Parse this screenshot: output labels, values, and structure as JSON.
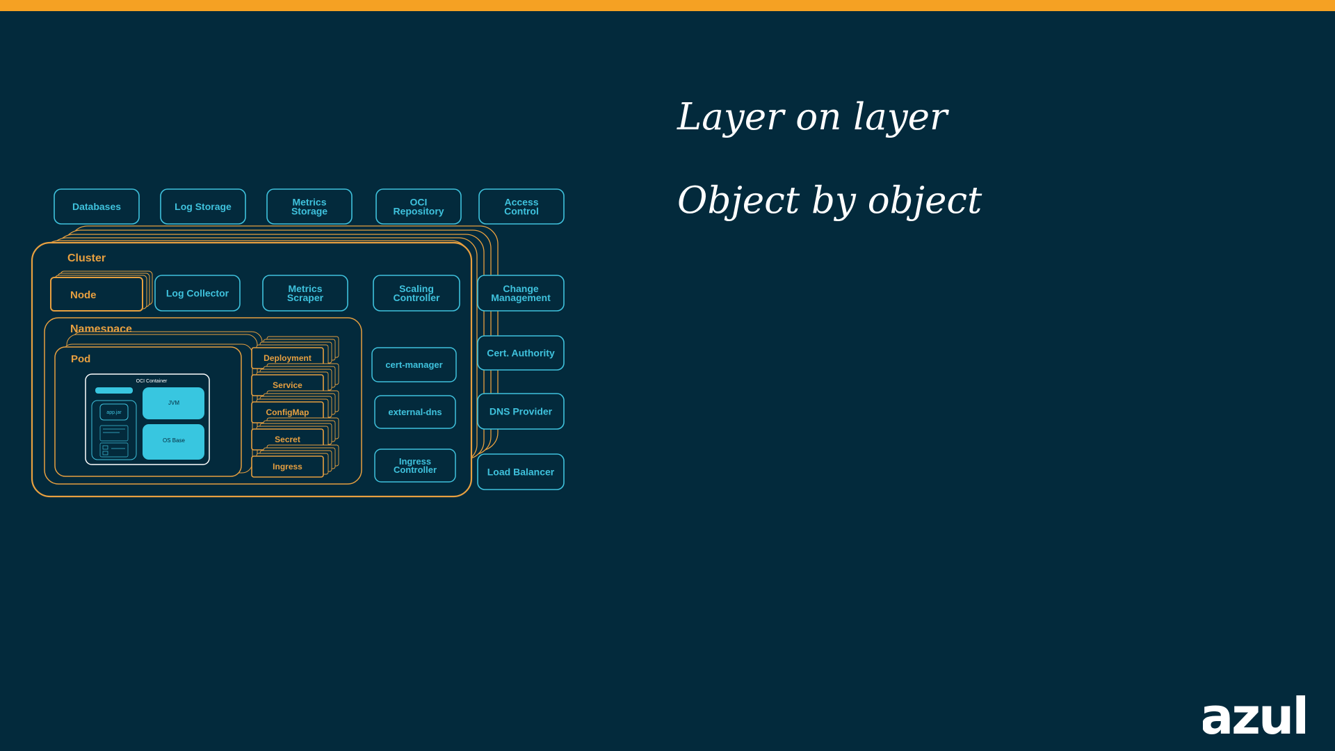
{
  "slide": {
    "title_line1": "Layer on layer",
    "title_line2": "Object by object",
    "brand": "azul"
  },
  "colors": {
    "background": "#032a3c",
    "top_bar": "#f5a123",
    "orange_outline": "#e8a040",
    "blue_outline": "#3fc2dd",
    "container_fill": "#38c6e0"
  },
  "diagram": {
    "external_top": [
      {
        "lines": [
          "Databases"
        ]
      },
      {
        "lines": [
          "Log Storage"
        ]
      },
      {
        "lines": [
          "Metrics",
          "Storage"
        ]
      },
      {
        "lines": [
          "OCI",
          "Repository"
        ]
      },
      {
        "lines": [
          "Access",
          "Control"
        ]
      }
    ],
    "external_right": [
      {
        "lines": [
          "Change",
          "Management"
        ]
      },
      {
        "lines": [
          "Cert. Authority"
        ]
      },
      {
        "lines": [
          "DNS Provider"
        ]
      },
      {
        "lines": [
          "Load Balancer"
        ]
      }
    ],
    "cluster_label": "Cluster",
    "node_label": "Node",
    "cluster_services": [
      {
        "lines": [
          "Log Collector"
        ]
      },
      {
        "lines": [
          "Metrics",
          "Scraper"
        ]
      },
      {
        "lines": [
          "Scaling",
          "Controller"
        ]
      }
    ],
    "namespace_label": "Namespace",
    "addons": [
      {
        "lines": [
          "cert-manager"
        ]
      },
      {
        "lines": [
          "external-dns"
        ]
      },
      {
        "lines": [
          "Ingress",
          "Controller"
        ]
      }
    ],
    "pod_label": "Pod",
    "container": {
      "label": "OCI Container",
      "app": "app.jar",
      "jvm": "JVM",
      "os": "OS Base"
    },
    "k8s_objects": [
      "Deployment",
      "Service",
      "ConfigMap",
      "Secret",
      "Ingress"
    ]
  }
}
